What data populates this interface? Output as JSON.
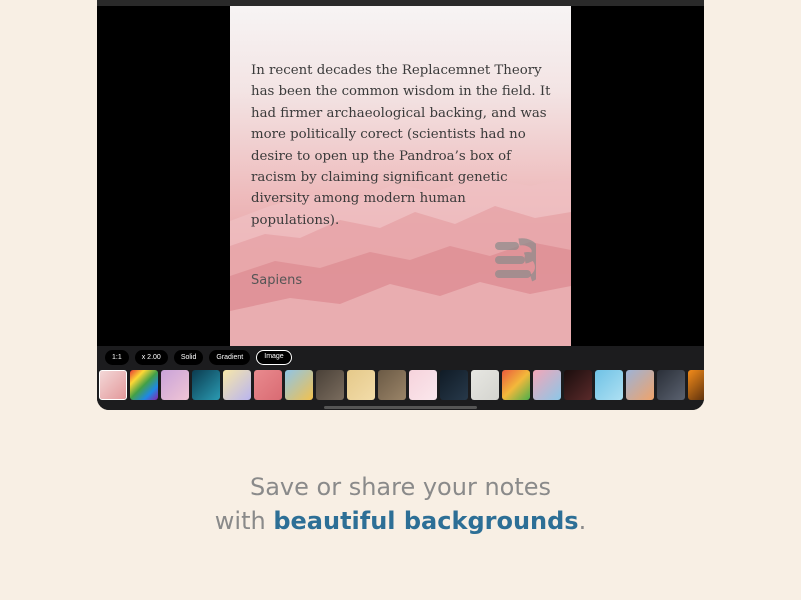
{
  "note": {
    "quote": "In recent decades the Replacemnet Theory has been the common wisdom in the field. It had firmer archaeological backing, and was more politically corect (scientists had no desire to open up the Pandroa’s box of racism by claiming significant genetic diversity among modern human populations).",
    "author": "Sapiens"
  },
  "toolbar": {
    "options": [
      {
        "label": "1:1",
        "active": false
      },
      {
        "label": "x 2.00",
        "active": false
      },
      {
        "label": "Solid",
        "active": false
      },
      {
        "label": "Gradient",
        "active": false
      },
      {
        "label": "Image",
        "active": true
      }
    ],
    "backgrounds": [
      {
        "name": "pink-mountains",
        "colors": [
          "#f3d7d7",
          "#e3999b"
        ],
        "selected": true
      },
      {
        "name": "rainbow-chevron",
        "colors": [
          "#e53935",
          "#fdd835",
          "#43a047",
          "#1e88e5",
          "#8e24aa"
        ]
      },
      {
        "name": "pastel-stripes",
        "colors": [
          "#c9a3d9",
          "#f0c5d5"
        ]
      },
      {
        "name": "teal-glow",
        "colors": [
          "#0b3b4f",
          "#2a9bb3"
        ]
      },
      {
        "name": "lemon-lilac",
        "colors": [
          "#f7e7a8",
          "#b9b5f0"
        ]
      },
      {
        "name": "coral-pink",
        "colors": [
          "#e98a8e",
          "#d96b73"
        ]
      },
      {
        "name": "sky-bird",
        "colors": [
          "#8fc5e8",
          "#f2c14e"
        ]
      },
      {
        "name": "dark-cliff",
        "colors": [
          "#4a4138",
          "#7a6c5e"
        ]
      },
      {
        "name": "golden-sand",
        "colors": [
          "#e5c98a",
          "#f2dca9"
        ]
      },
      {
        "name": "brown-texture",
        "colors": [
          "#6b5a45",
          "#9a8468"
        ]
      },
      {
        "name": "flower-pink",
        "colors": [
          "#f6d3dc",
          "#fbe7ec"
        ]
      },
      {
        "name": "night-sea",
        "colors": [
          "#101b26",
          "#27394a"
        ]
      },
      {
        "name": "marble-white",
        "colors": [
          "#e7e7e2",
          "#d4d4cf"
        ]
      },
      {
        "name": "warm-stripes",
        "colors": [
          "#e95b3c",
          "#f3b83b",
          "#4bb04b"
        ]
      },
      {
        "name": "holo-pink",
        "colors": [
          "#f3a6b8",
          "#8cc7e8"
        ]
      },
      {
        "name": "dark-portrait",
        "colors": [
          "#1a0d0d",
          "#5a2a2a"
        ]
      },
      {
        "name": "aqua-lemon",
        "colors": [
          "#6fc2e6",
          "#aee0f2"
        ]
      },
      {
        "name": "sunset-sky",
        "colors": [
          "#9db3d7",
          "#f0a36a"
        ]
      },
      {
        "name": "dusk-field",
        "colors": [
          "#2a2f38",
          "#5b6270"
        ]
      },
      {
        "name": "orange-sunset",
        "colors": [
          "#f48c1a",
          "#3a1c0a"
        ]
      }
    ]
  },
  "caption": {
    "line1": "Save or share your notes",
    "line2_prefix": "with ",
    "line2_highlight": "beautiful backgrounds",
    "line2_suffix": "."
  }
}
